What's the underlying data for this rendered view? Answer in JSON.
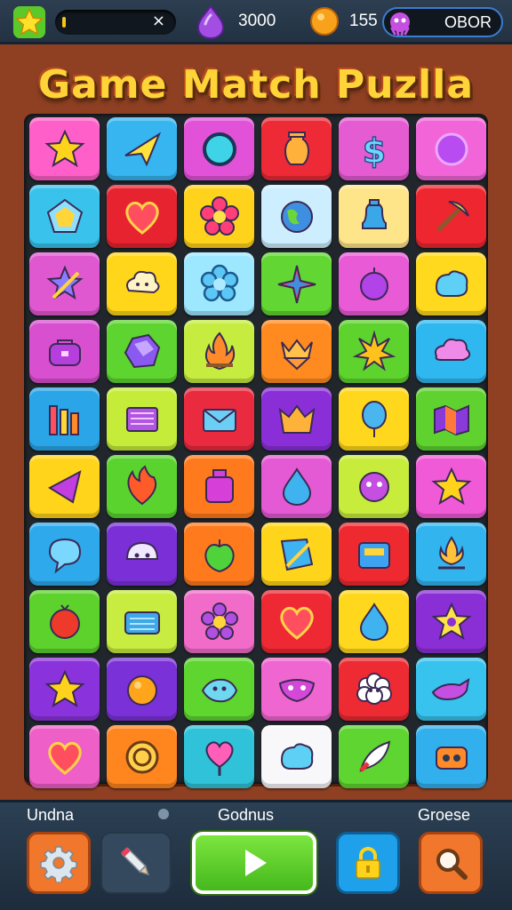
{
  "topbar": {
    "level_value": "×",
    "gems": "3000",
    "coins": "155",
    "score_label": "OBOR"
  },
  "title": "Game Match Puzlla",
  "colors": {
    "board_bg": "#8f4023",
    "title": "#ffd438",
    "play_button": "#5ad12b"
  },
  "tiles": [
    {
      "bg": "#ff5fc8",
      "icon": "star-icon"
    },
    {
      "bg": "#36b5f0",
      "icon": "paper-plane-icon"
    },
    {
      "bg": "#e252d8",
      "icon": "ring-icon"
    },
    {
      "bg": "#ee2a36",
      "icon": "vase-icon"
    },
    {
      "bg": "#e55bd2",
      "icon": "dollar-icon"
    },
    {
      "bg": "#f265d8",
      "icon": "orb-icon"
    },
    {
      "bg": "#38c2ec",
      "icon": "pentagon-icon"
    },
    {
      "bg": "#e6232f",
      "icon": "heart-icon"
    },
    {
      "bg": "#ffd21c",
      "icon": "flower-icon"
    },
    {
      "bg": "#cdeeff",
      "icon": "globe-icon"
    },
    {
      "bg": "#ffe58a",
      "icon": "bell-icon"
    },
    {
      "bg": "#ee2630",
      "icon": "pickaxe-icon"
    },
    {
      "bg": "#e058d0",
      "icon": "pencil-star-icon"
    },
    {
      "bg": "#ffd619",
      "icon": "cloud-face-icon"
    },
    {
      "bg": "#9ee8ff",
      "icon": "flower-outline-icon"
    },
    {
      "bg": "#62d632",
      "icon": "pinwheel-icon"
    },
    {
      "bg": "#e95ad6",
      "icon": "bubble-icon"
    },
    {
      "bg": "#ffd91e",
      "icon": "blob-icon"
    },
    {
      "bg": "#d84fd0",
      "icon": "bag-icon"
    },
    {
      "bg": "#5dd42f",
      "icon": "crystal-icon"
    },
    {
      "bg": "#c5ec3f",
      "icon": "flame-icon"
    },
    {
      "bg": "#ff8a1f",
      "icon": "crown-icon"
    },
    {
      "bg": "#5ed22d",
      "icon": "leaf-burst-icon"
    },
    {
      "bg": "#2fb8ef",
      "icon": "cloud-icon"
    },
    {
      "bg": "#2aa6e8",
      "icon": "bars-icon"
    },
    {
      "bg": "#c6ec3a",
      "icon": "book-icon"
    },
    {
      "bg": "#ea2a3e",
      "icon": "envelope-icon"
    },
    {
      "bg": "#8a2fd8",
      "icon": "crown-star-icon"
    },
    {
      "bg": "#ffd71c",
      "icon": "balloon-icon"
    },
    {
      "bg": "#5fd22f",
      "icon": "map-icon"
    },
    {
      "bg": "#ffd41a",
      "icon": "triangle-icon"
    },
    {
      "bg": "#5bd32f",
      "icon": "flame-heart-icon"
    },
    {
      "bg": "#ff7a1c",
      "icon": "jar-icon"
    },
    {
      "bg": "#e35ad4",
      "icon": "drop-icon"
    },
    {
      "bg": "#c8ec3c",
      "icon": "gear-face-icon"
    },
    {
      "bg": "#f05ad6",
      "icon": "star-icon"
    },
    {
      "bg": "#2ea9ec",
      "icon": "speech-icon"
    },
    {
      "bg": "#7a30d6",
      "icon": "ghost-face-icon"
    },
    {
      "bg": "#ff7a1d",
      "icon": "apple-icon"
    },
    {
      "bg": "#ffd51c",
      "icon": "shield-pencil-icon"
    },
    {
      "bg": "#ee2a30",
      "icon": "briefcase-icon"
    },
    {
      "bg": "#32b4ee",
      "icon": "crown-fire-icon"
    },
    {
      "bg": "#5dd12c",
      "icon": "tomato-icon"
    },
    {
      "bg": "#c8ec40",
      "icon": "radio-icon"
    },
    {
      "bg": "#f06cc8",
      "icon": "gear-flower-icon"
    },
    {
      "bg": "#ee2934",
      "icon": "heart-icon"
    },
    {
      "bg": "#ffd81e",
      "icon": "drop-icon"
    },
    {
      "bg": "#8a2fd6",
      "icon": "star-gear-icon"
    },
    {
      "bg": "#8a33dc",
      "icon": "star-icon"
    },
    {
      "bg": "#7a31d8",
      "icon": "orange-icon"
    },
    {
      "bg": "#5fd530",
      "icon": "fish-face-icon"
    },
    {
      "bg": "#f066d0",
      "icon": "mask-icon"
    },
    {
      "bg": "#ee2a32",
      "icon": "sheep-icon"
    },
    {
      "bg": "#38c2ee",
      "icon": "whale-icon"
    },
    {
      "bg": "#ef5fc8",
      "icon": "heart-icon"
    },
    {
      "bg": "#ff861f",
      "icon": "coin-icon"
    },
    {
      "bg": "#2fc2d8",
      "icon": "lollipop-icon"
    },
    {
      "bg": "#f8f8fa",
      "icon": "blob-icon"
    },
    {
      "bg": "#5fd531",
      "icon": "feather-icon"
    },
    {
      "bg": "#32b0ee",
      "icon": "robot-face-icon"
    }
  ],
  "bottombar": {
    "left_label": "Undna",
    "center_label": "Godnus",
    "right_label": "Groese",
    "buttons": [
      "settings-gear",
      "pencil",
      "play",
      "lock",
      "search"
    ]
  }
}
